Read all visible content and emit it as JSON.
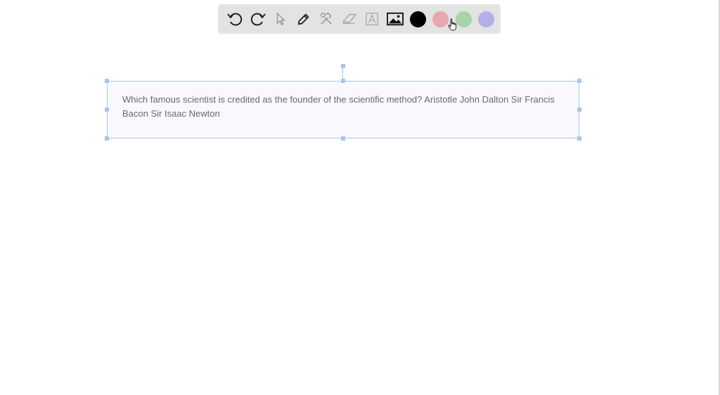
{
  "toolbar": {
    "tools": [
      {
        "name": "undo-button",
        "icon": "undo-icon",
        "enabled": true
      },
      {
        "name": "redo-button",
        "icon": "redo-icon",
        "enabled": true
      },
      {
        "name": "select-tool-button",
        "icon": "pointer-icon",
        "enabled": false
      },
      {
        "name": "pen-tool-button",
        "icon": "pencil-icon",
        "enabled": true
      },
      {
        "name": "tools-button",
        "icon": "hammer-wrench-icon",
        "enabled": false
      },
      {
        "name": "eraser-tool-button",
        "icon": "eraser-icon",
        "enabled": false
      },
      {
        "name": "text-tool-button",
        "icon": "text-box-icon",
        "enabled": false
      },
      {
        "name": "image-tool-button",
        "icon": "image-icon",
        "enabled": true
      }
    ],
    "colors": [
      "#000000",
      "#e8a6ad",
      "#a9d3a8",
      "#b3b0e8"
    ]
  },
  "textbox": {
    "text": "Which famous scientist is credited as the founder of the scientific method? Aristotle John Dalton Sir Francis Bacon Sir Isaac Newton"
  }
}
